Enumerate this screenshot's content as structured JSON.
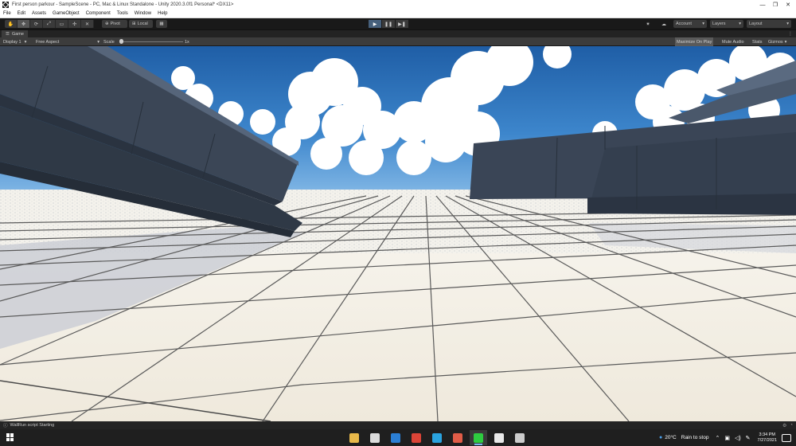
{
  "window": {
    "title": "First person parkour - SampleScene - PC, Mac & Linux Standalone - Unity 2020.3.0f1 Personal* <DX11>",
    "controls": [
      "—",
      "❐",
      "✕"
    ]
  },
  "menu": [
    "File",
    "Edit",
    "Assets",
    "GameObject",
    "Component",
    "Tools",
    "Window",
    "Help"
  ],
  "toolbar": {
    "tools": [
      "✋",
      "✥",
      "⟳",
      "⤢",
      "▭",
      "✣",
      "✕"
    ],
    "pivot_label": "Pivot",
    "local_label": "Local",
    "play_icon": "▶",
    "pause_icon": "❚❚",
    "step_icon": "▶❚",
    "account_label": "Account",
    "layers_label": "Layers",
    "layout_label": "Layout"
  },
  "game_tab": {
    "label": "Game",
    "menu": "⋮"
  },
  "game_bar": {
    "display": "Display 1",
    "aspect": "Free Aspect",
    "scale_label": "Scale",
    "scale_value": "1x",
    "maximize": "Maximize On Play",
    "mute": "Mute Audio",
    "stats": "Stats",
    "gizmos": "Gizmos"
  },
  "status": {
    "message": "WallRun script Starting"
  },
  "taskbar": {
    "apps": [
      {
        "name": "file-explorer-icon",
        "color": "#e8b94a"
      },
      {
        "name": "store-icon",
        "color": "#dcdcdc"
      },
      {
        "name": "mail-icon",
        "color": "#2b7fd4"
      },
      {
        "name": "chrome-icon",
        "color": "#db4437"
      },
      {
        "name": "telegram-icon",
        "color": "#2aa3df"
      },
      {
        "name": "browser-icon",
        "color": "#e05c47"
      },
      {
        "name": "game-icon",
        "color": "#2ecc40"
      },
      {
        "name": "unity-hub-icon",
        "color": "#e8e8e8"
      },
      {
        "name": "unity-icon",
        "color": "#cccccc"
      }
    ],
    "weather_temp": "20°C",
    "weather_text": "Rain to stop",
    "time": "3:34 PM",
    "date": "7/27/2021"
  },
  "colors": {
    "sky_top": "#1f5ea6",
    "sky_bottom": "#7fb6e6",
    "floor": "#f4f0e6",
    "beam": "#3e4a5b",
    "accent": "#46607c"
  }
}
